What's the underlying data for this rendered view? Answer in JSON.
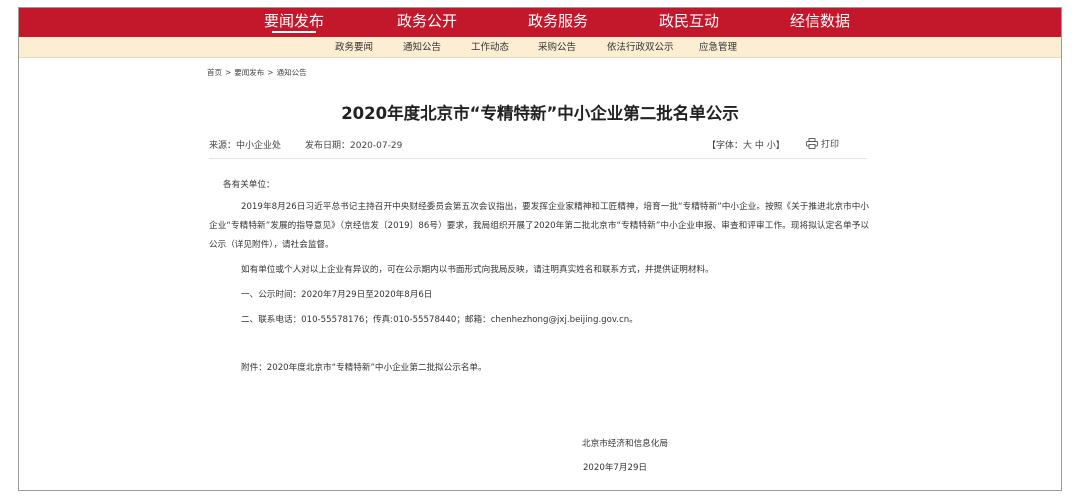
{
  "main_nav": [
    "要闻发布",
    "政务公开",
    "政务服务",
    "政民互动",
    "经信数据"
  ],
  "sub_nav": [
    "政务要闻",
    "通知公告",
    "工作动态",
    "采购公告",
    "依法行政双公示",
    "应急管理"
  ],
  "breadcrumb": [
    "首页",
    "要闻发布",
    "通知公告"
  ],
  "breadcrumb_sep": ">",
  "article": {
    "title": "2020年度北京市“专精特新”中小企业第二批名单公示",
    "source": "来源：中小企业处",
    "date": "发布日期：2020-07-29",
    "font_size_control": "【字体：大 中 小】",
    "print_label": "打印",
    "salutation": "各有关单位：",
    "paragraph1": "2019年8月26日习近平总书记主持召开中央财经委员会第五次会议指出，要发挥企业家精神和工匠精神，培育一批“专精特新”中小企业。按照《关于推进北京市中小企业“专精特新”发展的指导意见》（京经信发〔2019〕86号）要求，我局组织开展了2020年第二批北京市“专精特新”中小企业申报、审查和评审工作。现将拟认定名单予以公示（详见附件），请社会监督。",
    "paragraph2": "如有单位或个人对以上企业有异议的，可在公示期内以书面形式向我局反映，请注明真实姓名和联系方式，并提供证明材料。",
    "item1": "一、公示时间：2020年7月29日至2020年8月6日",
    "item2": "二、联系电话：010-55578176；传真:010-55578440；邮箱：chenhezhong@jxj.beijing.gov.cn。",
    "attachment": "附件：2020年度北京市“专精特新”中小企业第二批拟公示名单。",
    "signature_org": "北京市经济和信息化局",
    "signature_date": "2020年7月29日"
  }
}
